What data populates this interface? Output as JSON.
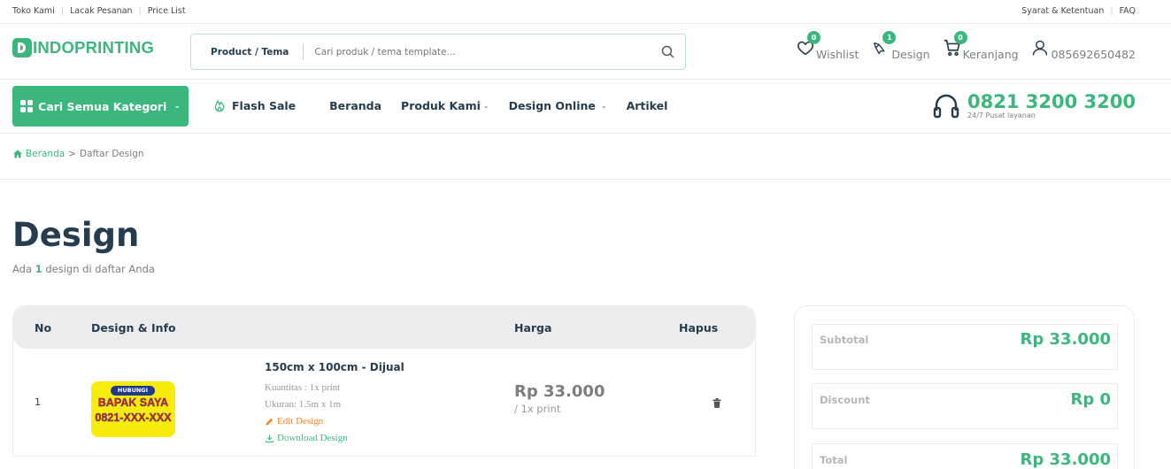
{
  "topbar": {
    "left_links": [
      "Toko Kami",
      "Lacak Pesanan",
      "Price List"
    ],
    "right_links": [
      "Syarat & Ketentuan",
      "FAQ"
    ]
  },
  "header": {
    "logo_text": "INDOPRINTING",
    "search": {
      "category": "Product / Tema",
      "placeholder": "Cari produk / tema template..."
    },
    "wishlist": {
      "label": "Wishlist",
      "count": "0"
    },
    "design": {
      "label": "Design",
      "count": "1"
    },
    "cart": {
      "label": "Keranjang",
      "count": "0"
    },
    "account": {
      "label": "085692650482"
    }
  },
  "nav": {
    "category_button": "Cari Semua Kategori",
    "items": [
      "Flash Sale",
      "Beranda",
      "Produk Kami",
      "Design Online",
      "Artikel"
    ],
    "hotline_number": "0821 3200 3200",
    "hotline_sub": "24/7 Pusat layanan"
  },
  "breadcrumb": {
    "home": "Beranda",
    "separator": ">",
    "current": "Daftar Design"
  },
  "page": {
    "title": "Design",
    "count_prefix": "Ada",
    "count": "1",
    "count_suffix": "design di daftar Anda"
  },
  "table": {
    "headers": {
      "no": "No",
      "design": "Design & Info",
      "price": "Harga",
      "delete": "Hapus"
    },
    "rows": [
      {
        "no": "1",
        "thumb_pill": "HUBUNGI",
        "thumb_line1": "BAPAK SAYA",
        "thumb_line2": "0821-XXX-XXX",
        "title": "150cm x 100cm - Dijual",
        "quantity": "Kuantitas : 1x print",
        "size": "Ukuran: 1.5m x 1m",
        "edit_label": "Edit Design",
        "download_label": "Download Design",
        "price": "Rp 33.000",
        "price_unit": "/ 1x print"
      }
    ]
  },
  "summary": {
    "subtotal_label": "Subtotal",
    "subtotal_value": "Rp 33.000",
    "discount_label": "Discount",
    "discount_value": "Rp 0",
    "total_label": "Total",
    "total_value": "Rp 33.000"
  },
  "colors": {
    "brand": "#3bb77e",
    "heading": "#253d4e",
    "edit": "#fd7e14"
  }
}
